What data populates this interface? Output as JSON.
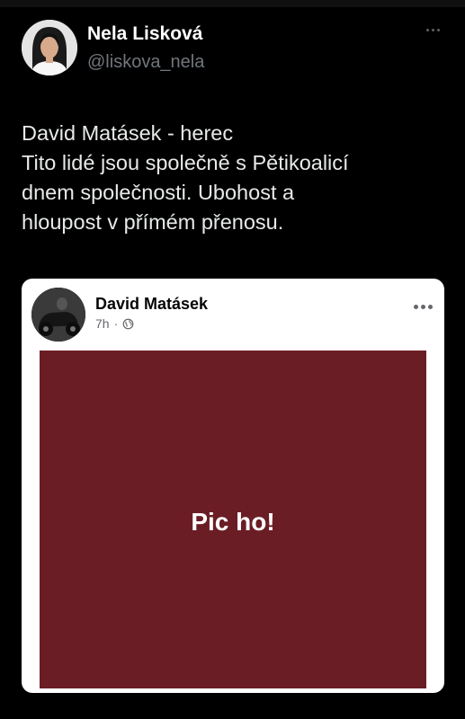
{
  "tweet": {
    "author_name": "Nela Lisková",
    "author_handle": "@liskova_nela",
    "more_icon": "more-horizontal-icon",
    "text_lines": [
      "David Matásek - herec",
      "Tito lidé jsou společně s Pětikoalicí",
      "dnem společnosti. Ubohost a",
      "hloupost v přímém přenosu."
    ]
  },
  "embedded_post": {
    "author_name": "David Matásek",
    "time": "7h",
    "separator": "·",
    "privacy_icon": "globe-icon",
    "more_icon": "more-horizontal-icon",
    "post_text": "Pic ho!",
    "post_background_color": "#6b1d25"
  },
  "colors": {
    "background": "#000000",
    "tweet_text": "#e7e9ea",
    "handle": "#71767b",
    "card_background": "#ffffff"
  }
}
